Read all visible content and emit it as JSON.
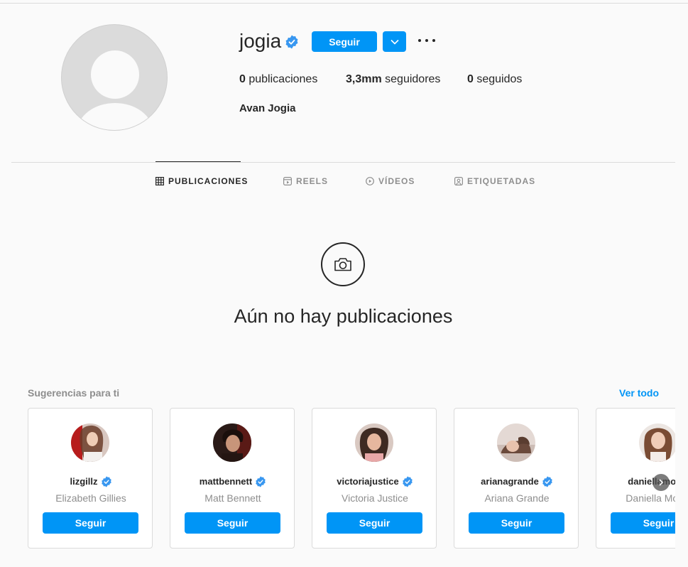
{
  "profile": {
    "username": "jogia",
    "follow_label": "Seguir",
    "full_name": "Avan Jogia",
    "stats": {
      "posts_count": "0",
      "posts_label": "publicaciones",
      "followers_count": "3,3mm",
      "followers_label": "seguidores",
      "following_count": "0",
      "following_label": "seguidos"
    }
  },
  "tabs": [
    {
      "label": "PUBLICACIONES",
      "icon": "grid-icon",
      "active": true
    },
    {
      "label": "REELS",
      "icon": "reels-icon",
      "active": false
    },
    {
      "label": "VÍDEOS",
      "icon": "play-circle-icon",
      "active": false
    },
    {
      "label": "ETIQUETADAS",
      "icon": "tagged-icon",
      "active": false
    }
  ],
  "empty_state": {
    "icon": "camera-icon",
    "title": "Aún no hay publicaciones"
  },
  "suggestions": {
    "title": "Sugerencias para ti",
    "see_all": "Ver todo",
    "items": [
      {
        "username": "lizgillz",
        "name": "Elizabeth Gillies",
        "button": "Seguir"
      },
      {
        "username": "mattbennett",
        "name": "Matt Bennett",
        "button": "Seguir"
      },
      {
        "username": "victoriajustice",
        "name": "Victoria Justice",
        "button": "Seguir"
      },
      {
        "username": "arianagrande",
        "name": "Ariana Grande",
        "button": "Seguir"
      },
      {
        "username": "daniellamonet",
        "name": "Daniella Monet",
        "button": "Seguir"
      }
    ]
  },
  "colors": {
    "accent": "#0095f6",
    "verified": "#3897f0",
    "text": "#262626",
    "muted": "#8e8e8e",
    "border": "#dbdbdb"
  }
}
